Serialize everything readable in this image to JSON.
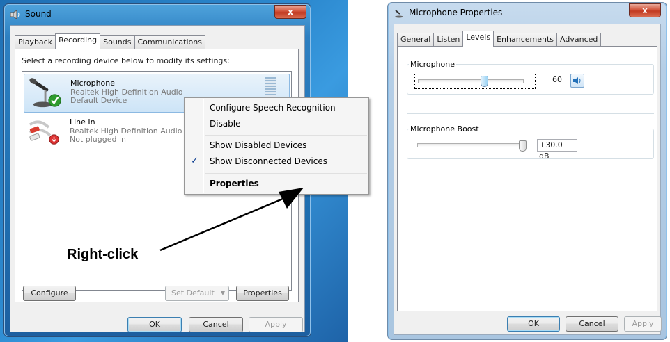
{
  "sound_dialog": {
    "title": "Sound",
    "close_label": "x",
    "tabs": [
      {
        "label": "Playback"
      },
      {
        "label": "Recording"
      },
      {
        "label": "Sounds"
      },
      {
        "label": "Communications"
      }
    ],
    "active_tab": "Recording",
    "instructions": "Select a recording device below to modify its settings:",
    "devices": [
      {
        "name": "Microphone",
        "driver": "Realtek High Definition Audio",
        "status": "Default Device",
        "selected": true,
        "icon": "microphone-icon",
        "badge": "check-badge-icon"
      },
      {
        "name": "Line In",
        "driver": "Realtek High Definition Audio",
        "status": "Not plugged in",
        "selected": false,
        "icon": "line-in-jack-icon",
        "badge": "unplugged-badge-icon"
      }
    ],
    "configure_label": "Configure",
    "set_default_label": "Set Default",
    "properties_label": "Properties",
    "ok_label": "OK",
    "cancel_label": "Cancel",
    "apply_label": "Apply"
  },
  "context_menu": {
    "items": [
      {
        "label": "Configure Speech Recognition",
        "checked": false,
        "bold": false
      },
      {
        "label": "Disable",
        "checked": false,
        "bold": false
      },
      {
        "label": "Show Disabled Devices",
        "checked": false,
        "bold": false
      },
      {
        "label": "Show Disconnected Devices",
        "checked": true,
        "bold": false
      },
      {
        "label": "Properties",
        "checked": false,
        "bold": true
      }
    ],
    "check_glyph": "✓"
  },
  "annotation": {
    "text": "Right-click"
  },
  "mic_properties": {
    "title": "Microphone Properties",
    "close_label": "x",
    "tabs": [
      {
        "label": "General"
      },
      {
        "label": "Listen"
      },
      {
        "label": "Levels"
      },
      {
        "label": "Enhancements"
      },
      {
        "label": "Advanced"
      }
    ],
    "active_tab": "Levels",
    "microphone": {
      "label": "Microphone",
      "value": "60",
      "level": 60,
      "speaker_icon": "speaker-icon"
    },
    "boost": {
      "label": "Microphone Boost",
      "value": "+30.0 dB",
      "level_fraction": 1.0
    },
    "ok_label": "OK",
    "cancel_label": "Cancel",
    "apply_label": "Apply"
  },
  "colors": {
    "title_gradient_top": "#4fa3dc",
    "close_red": "#c23b22",
    "selection_blue": "#cde4f7",
    "check_green": "#2e9b2e",
    "arrow_black": "#000000"
  }
}
